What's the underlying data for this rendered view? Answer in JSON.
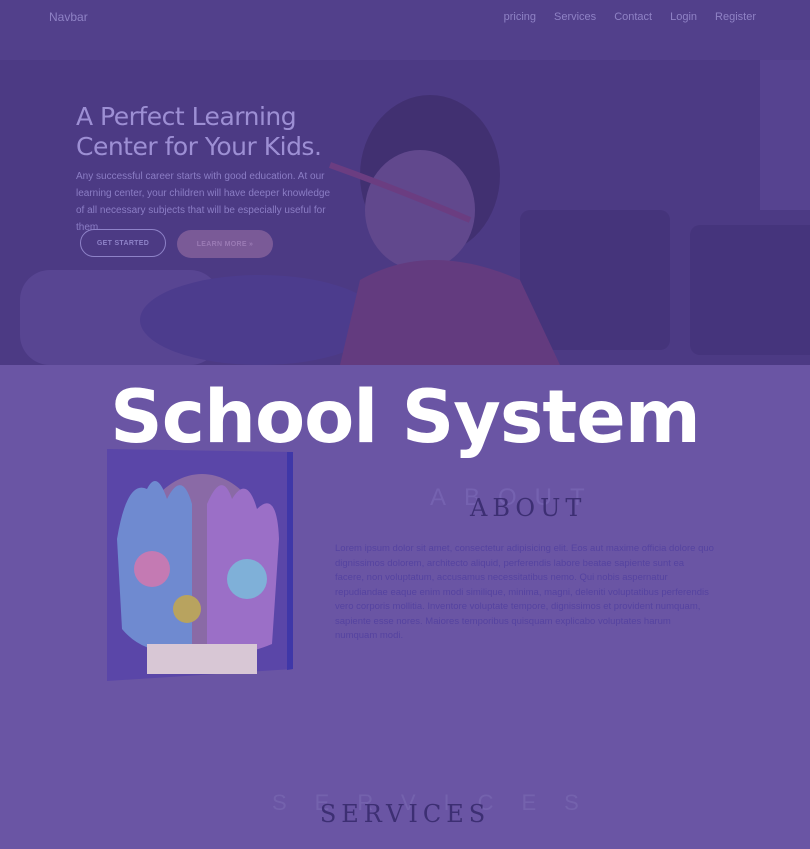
{
  "navbar": {
    "brand": "Navbar",
    "links": [
      "pricing",
      "Services",
      "Contact",
      "Login",
      "Register"
    ]
  },
  "hero": {
    "title": "A Perfect Learning Center for Your Kids.",
    "text": "Any successful career starts with good education. At our learning center, your children will have deeper knowledge of all necessary subjects that will be especially useful for them.",
    "get_started": "GET STARTED",
    "learn_more": "LEARN MORE"
  },
  "overlay_title": "School System",
  "about": {
    "ghost": "ABOUT",
    "heading": "ABOUT",
    "text": "Lorem ipsum dolor sit amet, consectetur adipisicing elit. Eos aut maxime officia dolore quo dignissimos dolorem, architecto aliquid, perferendis labore beatae sapiente sunt ea facere, non voluptatum, accusamus necessitatibus nemo. Qui nobis aspernatur repudiandae eaque enim modi similique, minima, magni, deleniti voluptatibus perferendis vero corporis mollitia. Inventore voluptate tempore, dignissimos et provident numquam, sapiente esse nores. Maiores temporibus quisquam explicabo voluptates harum numquam modi."
  },
  "services": {
    "ghost": "SERVICES",
    "heading": "SERVICES"
  },
  "colors": {
    "overlay": "#6a55a4",
    "hero_bg": "#4d3c83",
    "title_white": "#ffffff",
    "heading_dark": "#3d2f73"
  }
}
